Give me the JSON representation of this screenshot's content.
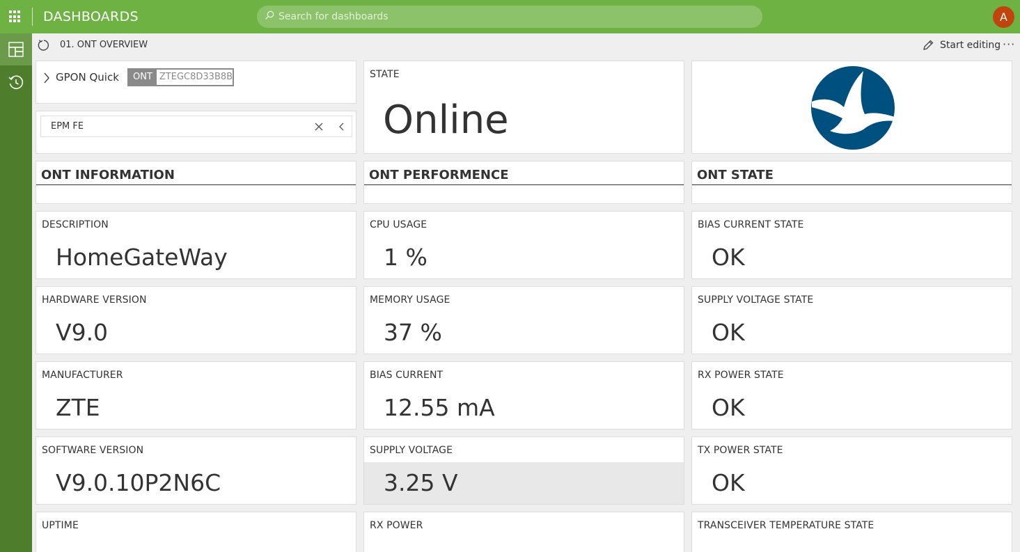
{
  "app": {
    "title": "DASHBOARDS",
    "avatar_initial": "A"
  },
  "search": {
    "placeholder": "Search for dashboards"
  },
  "rail": {
    "items": [
      "dashboards-icon",
      "history-icon"
    ]
  },
  "subheader": {
    "title": "01. ONT OVERVIEW",
    "edit_label": "Start editing",
    "more_label": "···"
  },
  "filter": {
    "quick_label": "GPON Quick",
    "chip_key": "ONT",
    "chip_value": "ZTEGC8D33B8B",
    "combo_value": "EPM FE"
  },
  "state_tile": {
    "label": "STATE",
    "value": "Online"
  },
  "sections": {
    "info": "ONT INFORMATION",
    "perf": "ONT PERFORMENCE",
    "state": "ONT STATE"
  },
  "info": [
    {
      "label": "DESCRIPTION",
      "value": "HomeGateWay"
    },
    {
      "label": "HARDWARE VERSION",
      "value": "V9.0"
    },
    {
      "label": "MANUFACTURER",
      "value": "ZTE"
    },
    {
      "label": "SOFTWARE VERSION",
      "value": "V9.0.10P2N6C"
    },
    {
      "label": "UPTIME",
      "value": ""
    }
  ],
  "perf": [
    {
      "label": "CPU USAGE",
      "value": "1 %"
    },
    {
      "label": "MEMORY USAGE",
      "value": "37 %"
    },
    {
      "label": "BIAS CURRENT",
      "value": "12.55 mA"
    },
    {
      "label": "SUPPLY VOLTAGE",
      "value": "3.25 V"
    },
    {
      "label": "RX POWER",
      "value": ""
    }
  ],
  "state": [
    {
      "label": "BIAS CURRENT STATE",
      "value": "OK"
    },
    {
      "label": "SUPPLY VOLTAGE STATE",
      "value": "OK"
    },
    {
      "label": "RX POWER STATE",
      "value": "OK"
    },
    {
      "label": "TX POWER STATE",
      "value": "OK"
    },
    {
      "label": "TRANSCEIVER TEMPERATURE STATE",
      "value": ""
    }
  ],
  "colors": {
    "topbar": "#6fb244",
    "rail": "#4e7d2c",
    "logo": "#00507f",
    "avatar": "#c1440e"
  }
}
